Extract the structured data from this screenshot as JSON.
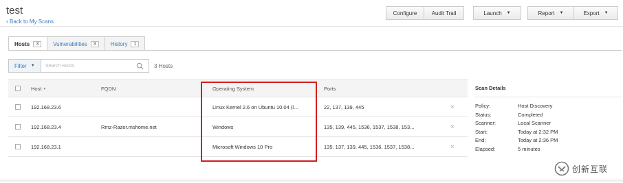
{
  "page": {
    "title": "test",
    "back_link": "Back to My Scans"
  },
  "toolbar": {
    "configure": "Configure",
    "audit_trail": "Audit Trail",
    "launch": "Launch",
    "report": "Report",
    "export": "Export"
  },
  "tabs": [
    {
      "label": "Hosts",
      "count": "3",
      "active": true
    },
    {
      "label": "Vulnerabilities",
      "count": "3",
      "active": false
    },
    {
      "label": "History",
      "count": "1",
      "active": false
    }
  ],
  "filter": {
    "label": "Filter",
    "search_placeholder": "Search Hosts",
    "host_count": "3 Hosts"
  },
  "table": {
    "columns": {
      "host": "Host",
      "fqdn": "FQDN",
      "os": "Operating System",
      "ports": "Ports"
    },
    "rows": [
      {
        "host": "192.168.23.6",
        "fqdn": "",
        "os": "Linux Kernel 2.6 on Ubuntu 10.04 (l...",
        "ports": "22, 137, 139, 445"
      },
      {
        "host": "192.168.23.4",
        "fqdn": "Rmz-Razer.mshome.net",
        "os": "Windows",
        "ports": "135, 139, 445, 1536, 1537, 1538, 153..."
      },
      {
        "host": "192.168.23.1",
        "fqdn": "",
        "os": "Microsoft Windows 10 Pro",
        "ports": "135, 137, 139, 445, 1536, 1537, 1538..."
      }
    ],
    "remove_icon": "×"
  },
  "scan_details": {
    "title": "Scan Details",
    "items": [
      {
        "label": "Policy:",
        "value": "Host Discovery"
      },
      {
        "label": "Status:",
        "value": "Completed"
      },
      {
        "label": "Scanner:",
        "value": "Local Scanner"
      },
      {
        "label": "Start:",
        "value": "Today at 2:32 PM"
      },
      {
        "label": "End:",
        "value": "Today at 2:36 PM"
      },
      {
        "label": "Elapsed:",
        "value": "5 minutes"
      }
    ]
  },
  "watermark": {
    "text": "创新互联"
  },
  "colors": {
    "link": "#3a7bbf",
    "highlight": "#d01f1f"
  }
}
